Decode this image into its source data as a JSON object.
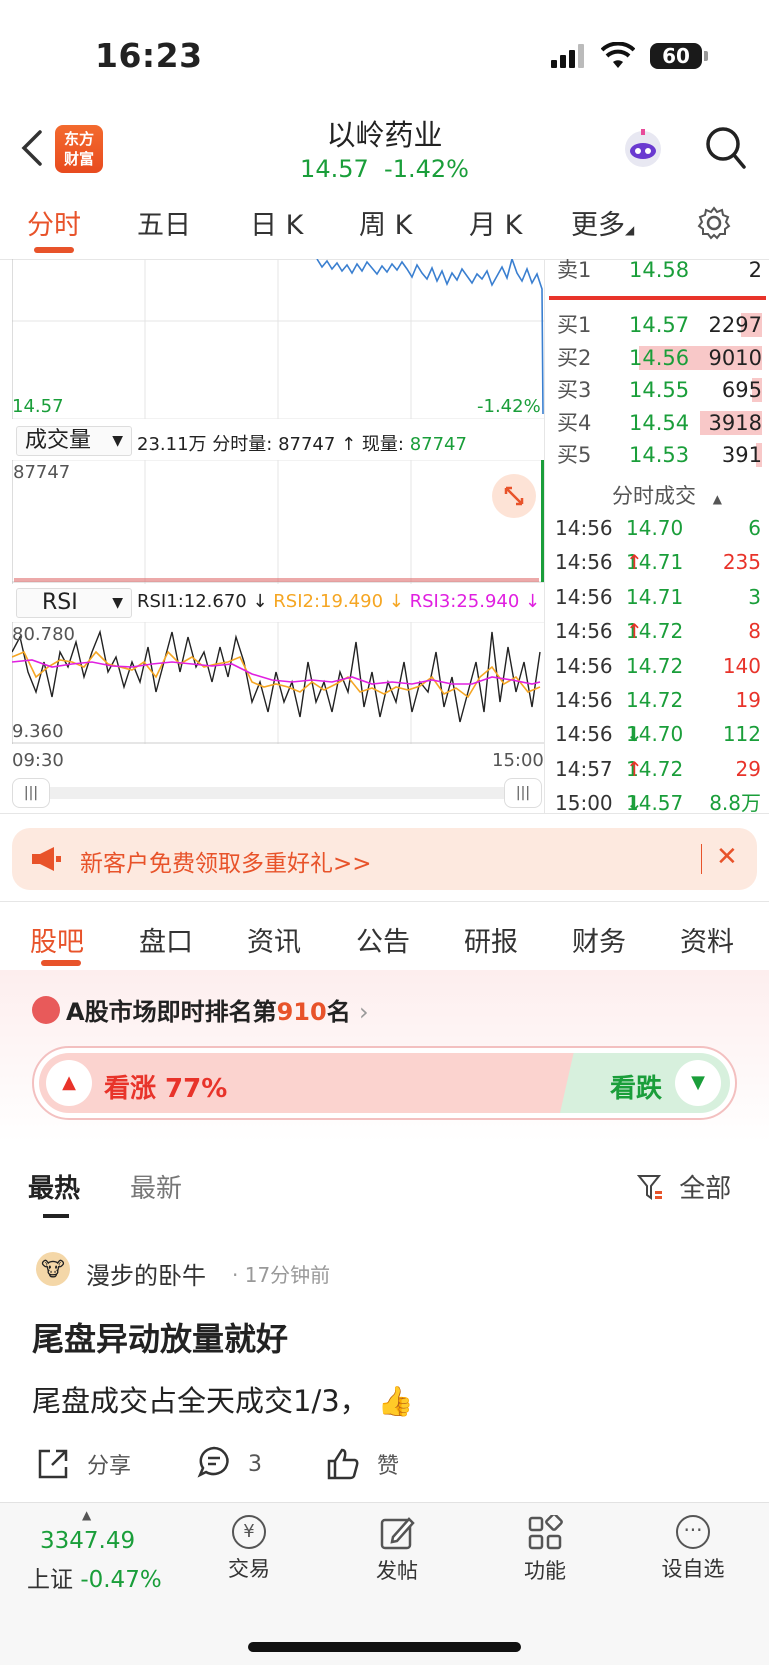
{
  "status_bar": {
    "time": "16:23",
    "battery": "60"
  },
  "header": {
    "logo_line1": "东方",
    "logo_line2": "财富",
    "stock_name": "以岭药业",
    "price": "14.57",
    "change_pct": "-1.42%"
  },
  "chart_tabs": [
    "分时",
    "五日",
    "日 K",
    "周 K",
    "月 K",
    "更多"
  ],
  "chart": {
    "price_low_label": "14.57",
    "pct_low_label": "-1.42%",
    "volume_indicator": "成交量",
    "volume_info_total": "23.11万",
    "volume_info_label": "分时量:",
    "volume_info_value": "87747",
    "volume_now_label": "现量:",
    "volume_now_value": "87747",
    "volume_max": "87747",
    "rsi_indicator": "RSI",
    "rsi1": "RSI1:12.670",
    "rsi2": "RSI2:19.490",
    "rsi3": "RSI3:25.940",
    "rsi_max": "80.780",
    "rsi_min": "9.360",
    "time_start": "09:30",
    "time_end": "15:00",
    "colors": {
      "price_line": "#3a7fd0",
      "rsi1": "#222222",
      "rsi2": "#f5a623",
      "rsi3": "#e020e0"
    }
  },
  "order_book": {
    "sell": [
      {
        "label": "卖1",
        "price": "14.58",
        "vol": "2"
      }
    ],
    "buy": [
      {
        "label": "买1",
        "price": "14.57",
        "vol": "2297",
        "bar": 0.1
      },
      {
        "label": "买2",
        "price": "14.56",
        "vol": "9010",
        "bar": 0.6
      },
      {
        "label": "买3",
        "price": "14.55",
        "vol": "695",
        "bar": 0.05
      },
      {
        "label": "买4",
        "price": "14.54",
        "vol": "3918",
        "bar": 0.3
      },
      {
        "label": "买5",
        "price": "14.53",
        "vol": "391",
        "bar": 0.03
      }
    ]
  },
  "ticks_title": "分时成交",
  "ticks": [
    {
      "time": "14:56",
      "price": "14.70",
      "arrow": "",
      "vol": "6",
      "color": "green"
    },
    {
      "time": "14:56",
      "price": "14.71",
      "arrow": "↑",
      "vol": "235",
      "color": "red"
    },
    {
      "time": "14:56",
      "price": "14.71",
      "arrow": "",
      "vol": "3",
      "color": "green"
    },
    {
      "time": "14:56",
      "price": "14.72",
      "arrow": "↑",
      "vol": "8",
      "color": "red"
    },
    {
      "time": "14:56",
      "price": "14.72",
      "arrow": "",
      "vol": "140",
      "color": "red"
    },
    {
      "time": "14:56",
      "price": "14.72",
      "arrow": "",
      "vol": "19",
      "color": "red"
    },
    {
      "time": "14:56",
      "price": "14.70",
      "arrow": "↓",
      "vol": "112",
      "color": "green"
    },
    {
      "time": "14:57",
      "price": "14.72",
      "arrow": "↑",
      "vol": "29",
      "color": "red"
    },
    {
      "time": "15:00",
      "price": "14.57",
      "arrow": "↓",
      "vol": "8.8万",
      "color": "green"
    }
  ],
  "banner": {
    "text": "新客户免费领取多重好礼>>"
  },
  "section_tabs": [
    "股吧",
    "盘口",
    "资讯",
    "公告",
    "研报",
    "财务",
    "资料"
  ],
  "ranking": {
    "prefix": "A股市场即时排名第",
    "rank": "910",
    "suffix": "名"
  },
  "sentiment": {
    "up_label": "看涨 77%",
    "down_label": "看跌",
    "up_fraction": 0.77
  },
  "feed_tabs": {
    "hot": "最热",
    "new": "最新",
    "filter": "全部"
  },
  "post": {
    "author": "漫步的卧牛",
    "time": "· 17分钟前",
    "title": "尾盘异动放量就好",
    "body": "尾盘成交占全天成交1/3，",
    "share": "分享",
    "comments": "3",
    "like": "赞"
  },
  "bottom_nav": {
    "index_value": "3347.49",
    "index_name": "上证",
    "index_change": "-0.47%",
    "trade": "交易",
    "post": "发帖",
    "functions": "功能",
    "watchlist": "设自选"
  }
}
